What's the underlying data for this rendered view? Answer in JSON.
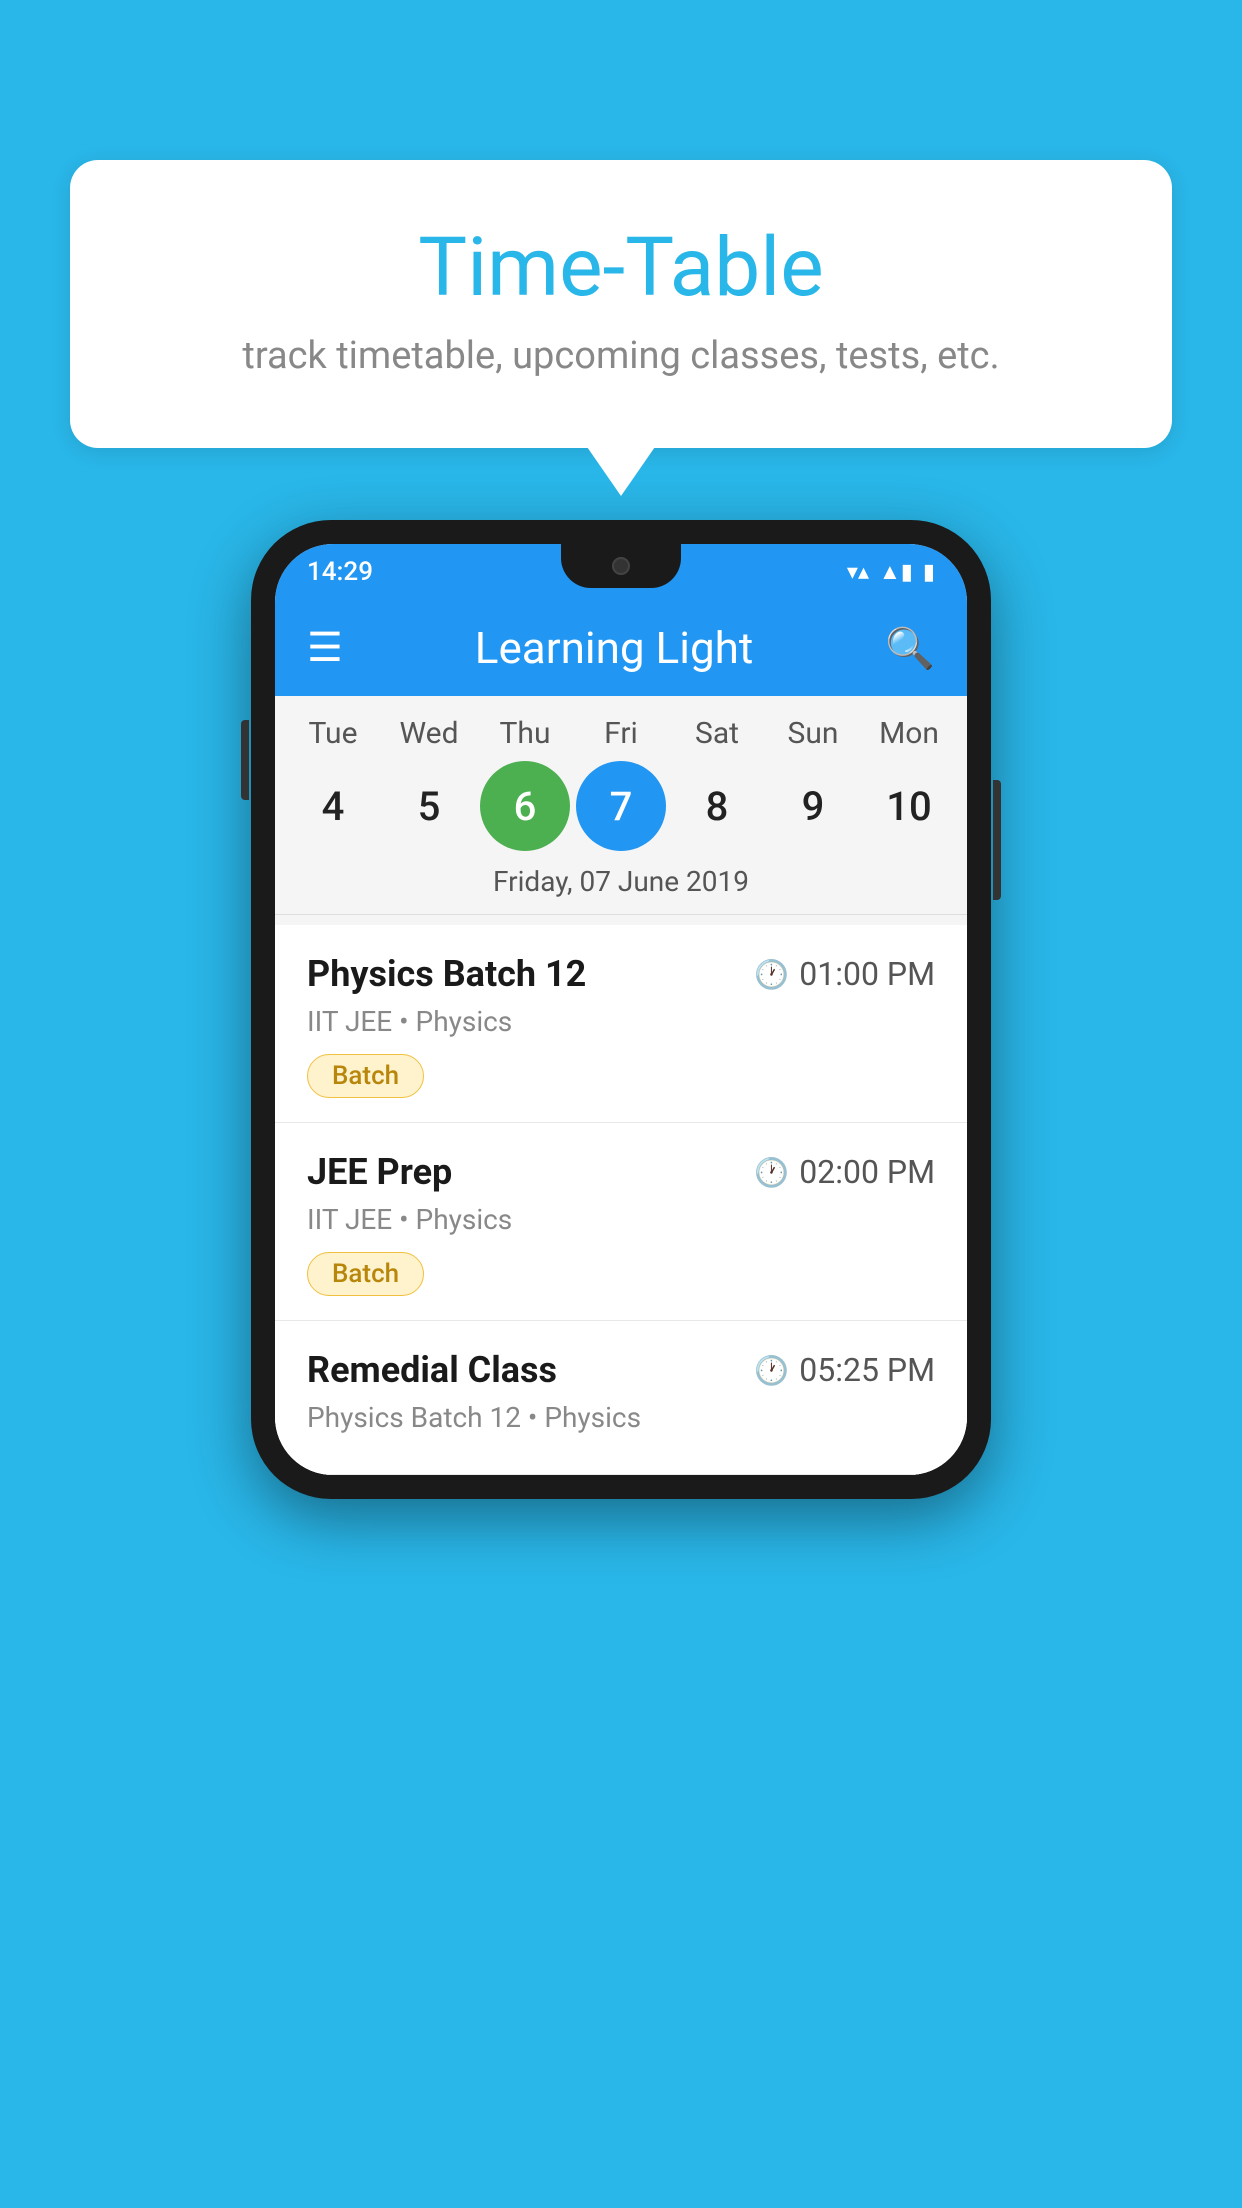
{
  "background_color": "#29b6e8",
  "bubble": {
    "title": "Time-Table",
    "subtitle": "track timetable, upcoming classes, tests, etc."
  },
  "status_bar": {
    "time": "14:29",
    "wifi": "▼▲",
    "battery": "▮"
  },
  "app_bar": {
    "title": "Learning Light",
    "menu_icon": "☰",
    "search_icon": "🔍"
  },
  "calendar": {
    "days": [
      {
        "label": "Tue",
        "number": "4"
      },
      {
        "label": "Wed",
        "number": "5"
      },
      {
        "label": "Thu",
        "number": "6",
        "state": "today"
      },
      {
        "label": "Fri",
        "number": "7",
        "state": "selected"
      },
      {
        "label": "Sat",
        "number": "8"
      },
      {
        "label": "Sun",
        "number": "9"
      },
      {
        "label": "Mon",
        "number": "10"
      }
    ],
    "selected_date_label": "Friday, 07 June 2019"
  },
  "schedule": {
    "items": [
      {
        "title": "Physics Batch 12",
        "time": "01:00 PM",
        "sub": "IIT JEE • Physics",
        "badge": "Batch"
      },
      {
        "title": "JEE Prep",
        "time": "02:00 PM",
        "sub": "IIT JEE • Physics",
        "badge": "Batch"
      },
      {
        "title": "Remedial Class",
        "time": "05:25 PM",
        "sub": "Physics Batch 12 • Physics",
        "badge": null
      }
    ]
  }
}
